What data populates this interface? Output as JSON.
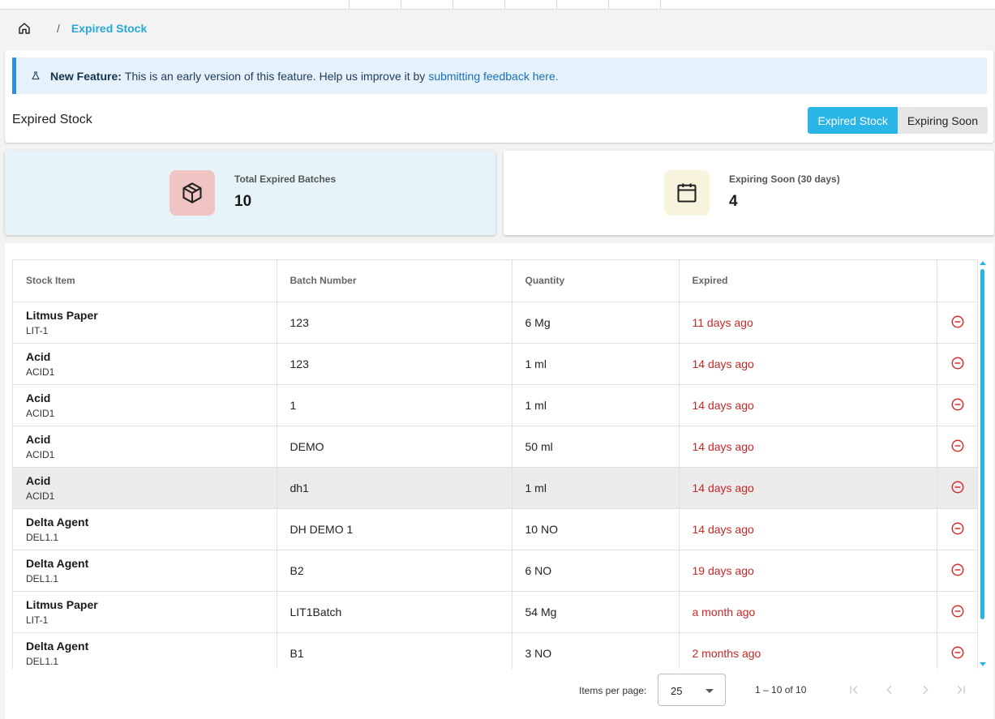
{
  "breadcrumb": {
    "separator": "/",
    "current": "Expired Stock"
  },
  "banner": {
    "title": "New Feature:",
    "text": "This is an early version of this feature. Help us improve it by",
    "link": "submitting feedback here."
  },
  "page": {
    "title": "Expired Stock"
  },
  "toggle": {
    "expired_label": "Expired Stock",
    "expiring_label": "Expiring Soon",
    "active": "Expired Stock"
  },
  "cards": {
    "expired": {
      "label": "Total Expired Batches",
      "value": "10",
      "icon": "package-icon"
    },
    "expiring": {
      "label": "Expiring Soon (30 days)",
      "value": "4",
      "icon": "calendar-icon"
    }
  },
  "table": {
    "headers": {
      "item": "Stock Item",
      "batch": "Batch Number",
      "quantity": "Quantity",
      "expired": "Expired"
    },
    "rows": [
      {
        "name": "Litmus Paper",
        "code": "LIT-1",
        "batch": "123",
        "quantity": "6 Mg",
        "expired": "11 days ago"
      },
      {
        "name": "Acid",
        "code": "ACID1",
        "batch": "123",
        "quantity": "1 ml",
        "expired": "14 days ago"
      },
      {
        "name": "Acid",
        "code": "ACID1",
        "batch": "1",
        "quantity": "1 ml",
        "expired": "14 days ago"
      },
      {
        "name": "Acid",
        "code": "ACID1",
        "batch": "DEMO",
        "quantity": "50 ml",
        "expired": "14 days ago"
      },
      {
        "name": "Acid",
        "code": "ACID1",
        "batch": "dh1",
        "quantity": "1 ml",
        "expired": "14 days ago"
      },
      {
        "name": "Delta Agent",
        "code": "DEL1.1",
        "batch": "DH DEMO 1",
        "quantity": "10 NO",
        "expired": "14 days ago"
      },
      {
        "name": "Delta Agent",
        "code": "DEL1.1",
        "batch": "B2",
        "quantity": "6 NO",
        "expired": "19 days ago"
      },
      {
        "name": "Litmus Paper",
        "code": "LIT-1",
        "batch": "LIT1Batch",
        "quantity": "54 Mg",
        "expired": "a month ago"
      },
      {
        "name": "Delta Agent",
        "code": "DEL1.1",
        "batch": "B1",
        "quantity": "3 NO",
        "expired": "2 months ago"
      }
    ]
  },
  "paginator": {
    "items_per_page_label": "Items per page:",
    "page_size": "25",
    "range": "1 – 10 of 10"
  },
  "colors": {
    "accent": "#29b6e6",
    "expired_text": "#c62828",
    "banner_bg": "#e5f1fb",
    "banner_border": "#2b8fe3"
  }
}
